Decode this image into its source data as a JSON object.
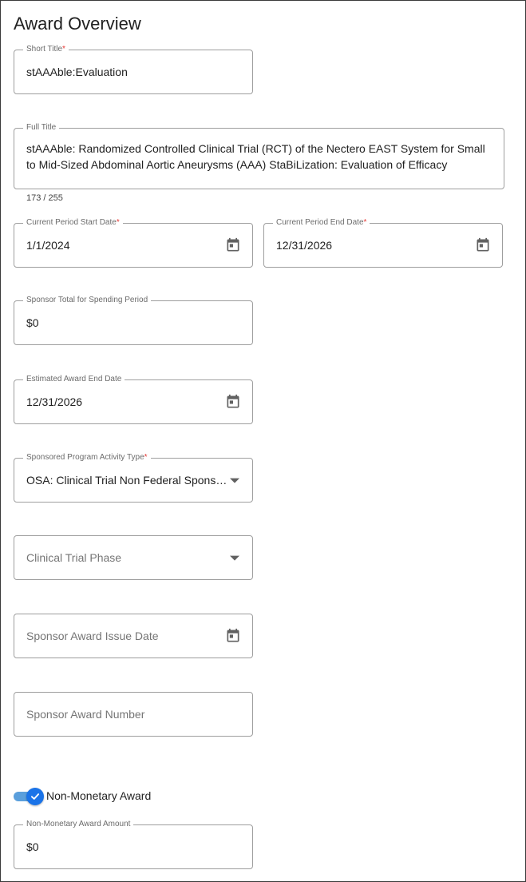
{
  "page": {
    "title": "Award Overview"
  },
  "fields": {
    "short_title": {
      "label": "Short Title",
      "required_mark": "*",
      "value": "stAAAble:Evaluation"
    },
    "full_title": {
      "label": "Full Title",
      "value": "stAAAble: Randomized Controlled Clinical Trial (RCT) of the Nectero EAST System for Small to Mid-Sized Abdominal Aortic Aneurysms (AAA) StaBiLization: Evaluation of Efficacy",
      "counter": "173 / 255"
    },
    "period_start": {
      "label": "Current Period Start Date",
      "required_mark": "*",
      "value": "1/1/2024",
      "icon": "calendar-icon"
    },
    "period_end": {
      "label": "Current Period End Date",
      "required_mark": "*",
      "value": "12/31/2026",
      "icon": "calendar-icon"
    },
    "sponsor_total": {
      "label": "Sponsor Total for Spending Period",
      "value": "$0"
    },
    "estimated_end": {
      "label": "Estimated Award End Date",
      "value": "12/31/2026",
      "icon": "calendar-icon"
    },
    "activity_type": {
      "label": "Sponsored Program Activity Type",
      "required_mark": "*",
      "value": "OSA: Clinical Trial Non Federal Sponsor Initiated",
      "icon": "dropdown-arrow-icon"
    },
    "trial_phase": {
      "placeholder": "Clinical Trial Phase",
      "icon": "dropdown-arrow-icon"
    },
    "issue_date": {
      "placeholder": "Sponsor Award Issue Date",
      "icon": "calendar-icon"
    },
    "award_number": {
      "placeholder": "Sponsor Award Number"
    },
    "non_monetary_toggle": {
      "label": "Non-Monetary Award",
      "checked": true
    },
    "non_monetary_amount": {
      "label": "Non-Monetary Award Amount",
      "value": "$0"
    }
  },
  "colors": {
    "accent": "#1a73e8",
    "required": "#e53935",
    "border": "#9e9e9e"
  }
}
